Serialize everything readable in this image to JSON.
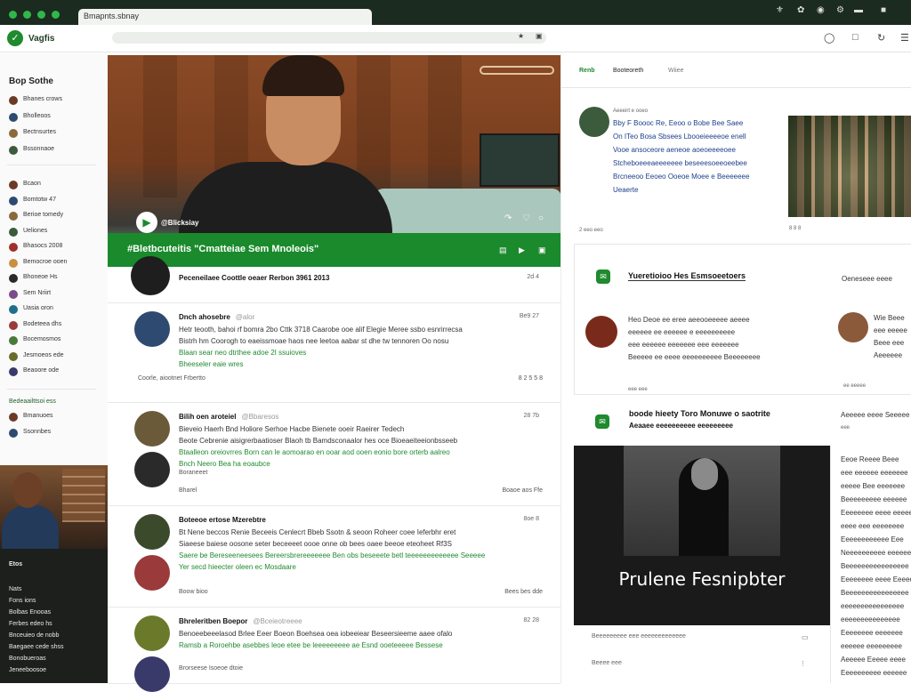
{
  "browser": {
    "tab_title": "Bmapnts.sbnay",
    "app_name": "Vagfis",
    "toolbar_icons": [
      "bird-icon",
      "leaf-icon",
      "github-icon",
      "settings-icon",
      "minimize-icon",
      "close-icon"
    ]
  },
  "sidebar": {
    "title": "Bop Sothe",
    "group1": [
      "Bhanes crows",
      "Bholleoos",
      "Bectnsurtes",
      "Bssonnaoe"
    ],
    "group2": [
      "Bcaon",
      "Bomtotw 47",
      "Berioe tomedy",
      "Ueliones",
      "Bhasocs 2008",
      "Bemocroe ooen",
      "Bhoneoe Hs",
      "Sem Nriirt",
      "Uasia oron",
      "Bodeteea dhs",
      "Bocemosmos",
      "Jesmoeos ede",
      "Beaoore ode"
    ],
    "section_label": "Bedeaailttsoi ess",
    "group3": [
      "Bmanuoes",
      "Ssonnbes"
    ],
    "dark_label": "Etos",
    "dark_items": [
      "Nats",
      "Fons ions",
      "Bolbas Enooas",
      "Ferbes edeo hs",
      "Bnceuieo de nobb",
      "Baegaee cede shss",
      "Bonobueroas",
      "Jeneeboosoe"
    ]
  },
  "hero": {
    "sub": "@Blicksiay",
    "title": "#Bletbcuteitis \"Cmatteiae Sem Mnoleois\""
  },
  "posts": [
    {
      "name": "Peceneilaee Coottle oeaer Rerbon 3961 2013",
      "time": "2d 4",
      "lines": [],
      "green": [],
      "footer": "",
      "footer_right": ""
    },
    {
      "name": "Dnch ahosebre",
      "name_sub": "@alor",
      "time": "Be9 27",
      "lines": [
        "Hetr teooth, bahoi rf bomra 2bo Cttk 3718 Caarobe ooe alif Elegie Meree ssbo esnrirrecsa",
        "Bistrh hm Coorogh to eaeissmoae haos nee leetoa aabar st dhe tw tennoren Oo nosu"
      ],
      "green": [
        "Blaan sear neo dtrthee adoe 2I ssuioves",
        "Bheeseler eaie wres"
      ],
      "footer": "Coorle, aiootnet Frbertto",
      "footer_right": "8 2 5 5 8"
    },
    {
      "name": "Bilih oen aroteiel",
      "name_sub": "@Bbaresos",
      "time": "28 7b",
      "lines": [
        "Bieveio Haerh Bnd Holiore  Serhoe Hacbe Bienete ooeir Raeirer Tedech",
        "Beote Cebrenie aisigrerbaatioser   Blaoh tb Bamdsconaalor hes oce   Bioeaeiteeionbsseeb"
      ],
      "green": [
        "Btaalleon oreiovrres Born can le aomoarao en ooar aod ooen eonio bore orterb aalreo",
        "Bnch Neero Bea ha eoaubce"
      ],
      "footer": "Bharel",
      "footer2": "Boraneeet",
      "footer_right": "Boaoe aos Ffe"
    },
    {
      "name": "Boteeoe ertose Mzerebtre",
      "time": "8oe 8",
      "lines": [
        "Bt Nene beccos Renie Beceeis Cenlecrt Bbeb Ssotn & seoon Roheer coee Ieferbhr eret",
        "Siaeese baiese oosone seter beceeeet oooe onne ob bees oaee beeoe eteoheet Rf3S"
      ],
      "green": [
        "Saere be Bereseeneesees Bereersbrereeeeeee Ben obs beseeete betl teeeeeeeeeeeee Seeeee",
        "Yer secd hieecter oleen ec Mosdaare"
      ],
      "footer": "Boow bioo",
      "footer_right": "Bees bes dde"
    },
    {
      "name": "Bhreleritben Boepor",
      "name_sub": "@Bceieotreeee",
      "time": "82 28",
      "lines": [
        "Benoeebeeelasod Brlee Eeer Boeon Boehsea oea iobeeiear Beseersieeme aaee ofalo"
      ],
      "green": [
        "Ramsb a Roroehbe asebbes leoe etee be leeeeeeeee ae Esnd ooeteeeee Bessese"
      ],
      "footer": "Brorseese Isoeoe dtoie",
      "footer_right": ""
    }
  ],
  "right": {
    "tabs": [
      "Renb",
      "Booteoreth",
      "Wiiee"
    ],
    "feature": {
      "label": "Aeeeirt e ooeo",
      "lines": [
        "Bby F Boooc Re, Eeoo o Bobe Bee Saee",
        "On ITeo Bosa Sbsees Lbooeieeeeoe enell",
        "Vooe ansoceore aeneoe aoeoeeeeoee",
        "Stcheboeeeaeeeeeee beseeesoeeoeebee",
        "Brcneeoo Eeoeo Ooeoe Moee e Beeeeeee",
        "Ueaerte"
      ],
      "footer": "2 eeo eeo",
      "img_caption": "8 8 8"
    },
    "card1": {
      "title": "Yueretioioo Hes Esmsoeetoers",
      "right_title": "Oeneseee eeee",
      "lines": [
        "Heo Deoe ee eree aeeooeeeee aeeee",
        "eeeeee ee eeeeee e eeeeeeeeee",
        "eee eeeeee eeeeeee eee eeeeeee",
        "Beeeee ee eeee eeeeeeeeee Beeeeeeee"
      ],
      "foot": "eee eee",
      "right_lines": [
        "Wie Beee",
        "eee eeeee",
        "Beee eee",
        "Aeeeeee"
      ],
      "right_foot": "ee eeeee"
    },
    "card2": {
      "title": "boode hieety Toro Monuwe o saotrite",
      "sub": "Aeaaee eeeeeeeeee eeeeeeeee",
      "right_title": "Aeeeee eeee Seeeee",
      "right_small": "eee"
    },
    "bw_caption": "Prulene Fesnipbter",
    "bottom": [
      "Beeeeeeeee eee eeeeeeeeeeeee",
      "Beeee eee"
    ],
    "right_col": [
      "Eeoe Reeee Beee",
      "eee eeeeee eeeeeee",
      "eeeee Bee eeeeeee",
      "Beeeeeeeee eeeeee",
      "Eeeeeeee eeee eeeeee",
      "eeee eee eeeeeeee",
      "Eeeeeeeeeeee Eee",
      "Neeeeeeeeee eeeeee",
      "Beeeeeeeeeeeeeeee",
      "Eeeeeeee eeee Eeeee",
      "Beeeeeeeeeeeeeeee",
      "eeeeeeeeeeeeeeee",
      "eeeeeeeeeeeeeee",
      "Eeeeeeee eeeeeee",
      "eeeeee eeeeeeeee",
      "Aeeeee Eeeee eeee",
      "Eeeeeeeeee eeeeee"
    ]
  }
}
